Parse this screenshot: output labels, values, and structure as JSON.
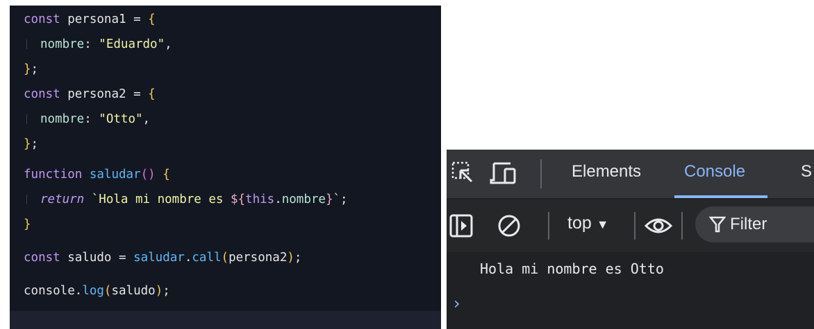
{
  "editor": {
    "lines": [
      {
        "kw": "const",
        "name": "persona1",
        "op": " = ",
        "brace": "{"
      },
      {
        "prop": "nombre",
        "str": "\"Eduardo\""
      },
      {
        "close": "}",
        "semi": ";"
      },
      {
        "kw": "const",
        "name": "persona2",
        "op": " = ",
        "brace": "{"
      },
      {
        "prop": "nombre",
        "str": "\"Otto\""
      },
      {
        "close": "}",
        "semi": ";"
      },
      {
        "kw": "function",
        "name": "saludar",
        "parens": "()",
        "brace": "{"
      },
      {
        "kw": "return",
        "tmpl_start": "`Hola mi nombre es ",
        "interp_open": "${",
        "this": "this",
        "dot": ".",
        "member": "nombre",
        "interp_close": "}",
        "tmpl_end": "`",
        "semi": ";"
      },
      {
        "close": "}"
      },
      {
        "kw": "const",
        "name": "saludo",
        "op": " = ",
        "callee": "saludar",
        "dot": ".",
        "method": "call",
        "arg": "persona2",
        "semi": ";"
      },
      {
        "obj": "console",
        "dot": ".",
        "method": "log",
        "arg": "saludo",
        "semi": ";"
      }
    ]
  },
  "devtools": {
    "tabs": [
      "Elements",
      "Console",
      "S"
    ],
    "active_tab": "Console",
    "context": "top",
    "filter_label": "Filter",
    "console_output": "Hola mi nombre es Otto",
    "prompt_symbol": "›"
  }
}
